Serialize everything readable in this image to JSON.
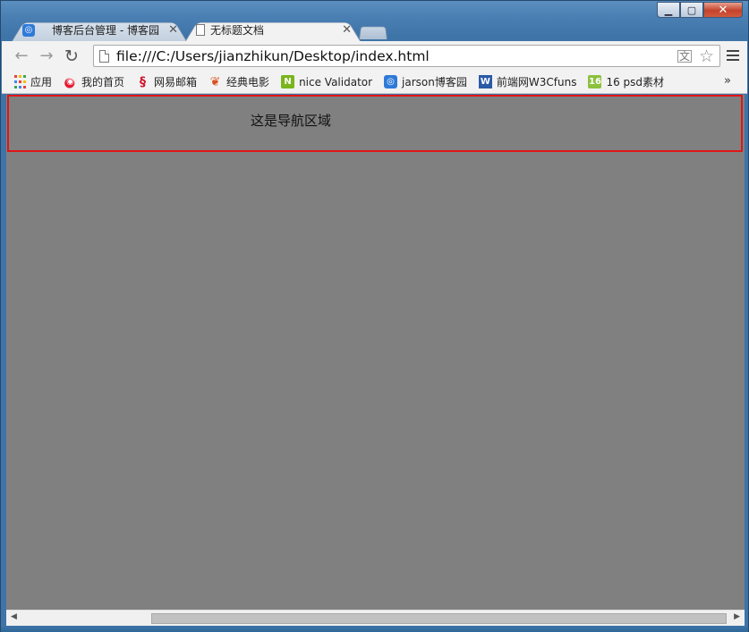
{
  "window": {
    "controls": {
      "minimize": "▁",
      "maximize": "▢",
      "close": "✕"
    }
  },
  "tabs": [
    {
      "label": "博客后台管理 - 博客园",
      "icon": "cnblogs-icon",
      "state": "inactive"
    },
    {
      "label": "无标题文档",
      "icon": "page-icon",
      "state": "active"
    }
  ],
  "toolbar": {
    "back_icon": "←",
    "forward_icon": "→",
    "reload_icon": "C",
    "url": "file:///C:/Users/jianzhikun/Desktop/index.html"
  },
  "bookmarks": {
    "items": [
      {
        "label": "应用",
        "icon": "apps-icon"
      },
      {
        "label": "我的首页",
        "icon": "weibo-icon"
      },
      {
        "label": "网易邮箱",
        "icon": "netease-mail-icon"
      },
      {
        "label": "经典电影",
        "icon": "leaf-icon"
      },
      {
        "label": "nice Validator",
        "icon": "nice-icon",
        "glyph": "N"
      },
      {
        "label": "jarson博客园",
        "icon": "cnblogs-icon",
        "glyph": "◎"
      },
      {
        "label": "前端网W3Cfuns",
        "icon": "w3cfuns-icon",
        "glyph": "W"
      },
      {
        "label": "16 psd素材",
        "icon": "psd-icon",
        "glyph": "16"
      }
    ],
    "more": "»"
  },
  "page": {
    "background": "#808080",
    "nav_border_color": "#e01515",
    "nav_text": "这是导航区域"
  },
  "scrollbar": {
    "left_arrow": "◀",
    "right_arrow": "▶"
  }
}
